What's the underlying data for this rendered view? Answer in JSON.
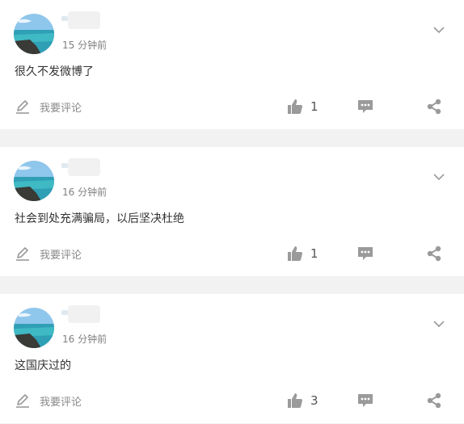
{
  "posts": [
    {
      "time": "15 分钟前",
      "text": "很久不发微博了",
      "comment_label": "我要评论",
      "likes": "1"
    },
    {
      "time": "16 分钟前",
      "text": "社会到处充满骗局，以后坚决杜绝",
      "comment_label": "我要评论",
      "likes": "1"
    },
    {
      "time": "16 分钟前",
      "text": "这国庆过的",
      "comment_label": "我要评论",
      "likes": "3"
    }
  ],
  "icons": {
    "avatar": "avatar-beach-photo",
    "menu": "chevron-down-icon",
    "comment": "edit-pencil-icon",
    "like": "thumbs-up-icon",
    "reply": "speech-bubble-icon",
    "share": "share-icon"
  },
  "colors": {
    "background": "#f2f2f2",
    "card": "#ffffff",
    "icon": "#9a9a9a",
    "muted_text": "#8a8a8a"
  }
}
